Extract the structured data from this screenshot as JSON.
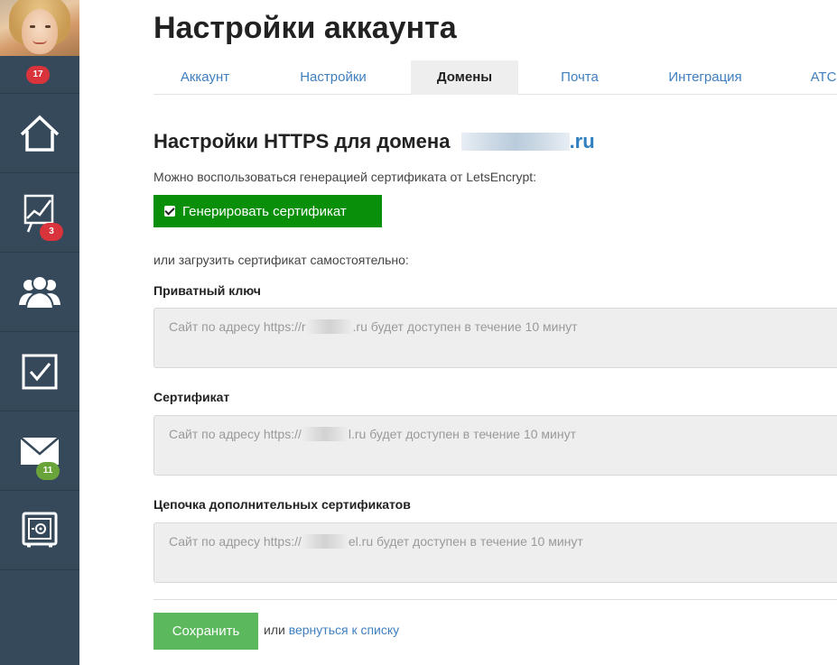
{
  "sidebar": {
    "notification_count": "17",
    "items": [
      {
        "name": "home",
        "icon": "home-icon"
      },
      {
        "name": "analytics",
        "icon": "chart-icon",
        "badge": "3"
      },
      {
        "name": "contacts",
        "icon": "users-icon"
      },
      {
        "name": "tasks",
        "icon": "checkbox-icon"
      },
      {
        "name": "mail",
        "icon": "mail-icon",
        "badge": "11"
      },
      {
        "name": "settings",
        "icon": "safe-icon"
      }
    ]
  },
  "page": {
    "title": "Настройки аккаунта"
  },
  "tabs": [
    {
      "label": "Аккаунт",
      "active": false
    },
    {
      "label": "Настройки",
      "active": false
    },
    {
      "label": "Домены",
      "active": true
    },
    {
      "label": "Почта",
      "active": false
    },
    {
      "label": "Интеграция",
      "active": false
    },
    {
      "label": "АТС",
      "active": false
    }
  ],
  "https": {
    "title_prefix": "Настройки HTTPS для домена ",
    "domain_suffix": ".ru",
    "letsencrypt_hint": "Можно воспользоваться генерацией сертификата от LetsEncrypt:",
    "generate_label": "Генерировать сертификат",
    "generate_checked": true,
    "manual_hint": "или загрузить сертификат самостоятельно:"
  },
  "fields": [
    {
      "label": "Приватный ключ",
      "value_prefix": "Сайт по адресу https://r",
      "value_suffix": ".ru будет доступен в течение 10 минут"
    },
    {
      "label": "Сертификат",
      "value_prefix": "Сайт по адресу https://",
      "value_suffix": "l.ru будет доступен в течение 10 минут"
    },
    {
      "label": "Цепочка дополнительных сертификатов",
      "value_prefix": "Сайт по адресу https://",
      "value_suffix": "el.ru будет доступен в течение 10 минут"
    }
  ],
  "footer": {
    "save_label": "Сохранить",
    "or_text": "или ",
    "back_link": "вернуться к списку"
  },
  "colors": {
    "sidebar": "#36495b",
    "generate_button": "#0a8f0a",
    "save_button": "#5cb85c",
    "link": "#3f7fbf",
    "badge_red": "#d9333b",
    "badge_green": "#6aa33a"
  }
}
